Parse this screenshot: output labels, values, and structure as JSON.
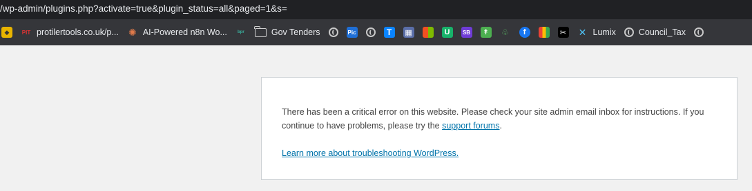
{
  "browser": {
    "url": "/wp-admin/plugins.php?activate=true&plugin_status=all&paged=1&s=",
    "bookmarks": [
      {
        "label": "",
        "icon": "yellow-cube-icon"
      },
      {
        "label": "protilertools.co.uk/p...",
        "icon": "pit-icon"
      },
      {
        "label": "AI-Powered n8n Wo...",
        "icon": "starburst-icon"
      },
      {
        "label": "",
        "icon": "small-logo-icon"
      },
      {
        "label": "Gov Tenders",
        "icon": "folder-icon"
      },
      {
        "label": "",
        "icon": "globe-icon"
      },
      {
        "label": "",
        "icon": "pic-icon"
      },
      {
        "label": "",
        "icon": "globe-icon"
      },
      {
        "label": "",
        "icon": "t-icon"
      },
      {
        "label": "",
        "icon": "grid-icon"
      },
      {
        "label": "",
        "icon": "microsoft-icon"
      },
      {
        "label": "",
        "icon": "u-icon"
      },
      {
        "label": "",
        "icon": "sb-icon"
      },
      {
        "label": "",
        "icon": "stock-icon"
      },
      {
        "label": "",
        "icon": "tree-icon"
      },
      {
        "label": "",
        "icon": "facebook-icon"
      },
      {
        "label": "",
        "icon": "shopping-bag-icon"
      },
      {
        "label": "",
        "icon": "capcut-icon"
      },
      {
        "label": "Lumix",
        "icon": "lumix-icon"
      },
      {
        "label": "Council_Tax",
        "icon": "globe-icon"
      },
      {
        "label": "",
        "icon": "globe-icon"
      }
    ]
  },
  "error": {
    "message_before_link": "There has been a critical error on this website. Please check your site admin email inbox for instructions. If you continue to have problems, please try the ",
    "support_link": "support forums",
    "message_after_link": ".",
    "learn_more_link": "Learn more about troubleshooting WordPress."
  }
}
